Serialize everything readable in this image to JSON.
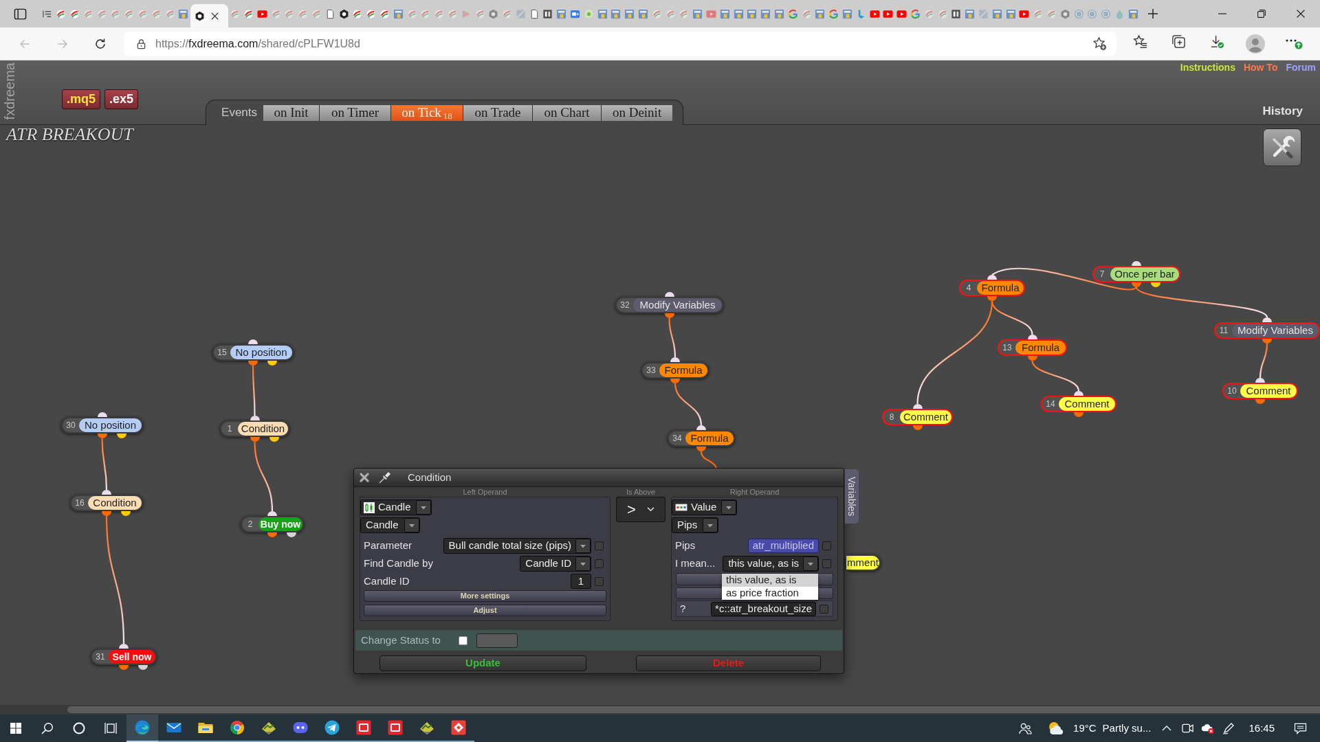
{
  "browser": {
    "tabs": [
      {
        "kind": "list",
        "asleep": false,
        "selected": false
      },
      {
        "kind": "fx",
        "asleep": false,
        "selected": false
      },
      {
        "kind": "fx",
        "asleep": false,
        "selected": false
      },
      {
        "kind": "fx",
        "asleep": true,
        "selected": false
      },
      {
        "kind": "fx",
        "asleep": true,
        "selected": false
      },
      {
        "kind": "fx",
        "asleep": true,
        "selected": false
      },
      {
        "kind": "fx",
        "asleep": true,
        "selected": false
      },
      {
        "kind": "fx",
        "asleep": true,
        "selected": false
      },
      {
        "kind": "fx",
        "asleep": true,
        "selected": false
      },
      {
        "kind": "fx",
        "asleep": true,
        "selected": false
      },
      {
        "kind": "mql",
        "asleep": false,
        "selected": false
      },
      {
        "kind": "hex",
        "asleep": false,
        "selected": true
      },
      {
        "kind": "fx",
        "asleep": true,
        "selected": false
      },
      {
        "kind": "fx",
        "asleep": false,
        "selected": false
      },
      {
        "kind": "yt",
        "asleep": false,
        "selected": false
      },
      {
        "kind": "fx",
        "asleep": true,
        "selected": false
      },
      {
        "kind": "fx",
        "asleep": true,
        "selected": false
      },
      {
        "kind": "fx",
        "asleep": true,
        "selected": false
      },
      {
        "kind": "fx",
        "asleep": true,
        "selected": false
      },
      {
        "kind": "doc",
        "asleep": false,
        "selected": false
      },
      {
        "kind": "hex",
        "asleep": false,
        "selected": false
      },
      {
        "kind": "fx",
        "asleep": false,
        "selected": false
      },
      {
        "kind": "fx",
        "asleep": false,
        "selected": false
      },
      {
        "kind": "fx",
        "asleep": false,
        "selected": false
      },
      {
        "kind": "mql",
        "asleep": false,
        "selected": false
      },
      {
        "kind": "fx",
        "asleep": true,
        "selected": false
      },
      {
        "kind": "fx",
        "asleep": true,
        "selected": false
      },
      {
        "kind": "fx",
        "asleep": true,
        "selected": false
      },
      {
        "kind": "fx",
        "asleep": true,
        "selected": false
      },
      {
        "kind": "flag",
        "asleep": true,
        "selected": false
      },
      {
        "kind": "fx",
        "asleep": true,
        "selected": false
      },
      {
        "kind": "hex",
        "asleep": true,
        "selected": false
      },
      {
        "kind": "fx",
        "asleep": true,
        "selected": false
      },
      {
        "kind": "tile",
        "asleep": true,
        "selected": false
      },
      {
        "kind": "doc",
        "asleep": false,
        "selected": false
      },
      {
        "kind": "misc",
        "asleep": false,
        "selected": false
      },
      {
        "kind": "mql",
        "asleep": false,
        "selected": false
      },
      {
        "kind": "cam",
        "asleep": false,
        "selected": false
      },
      {
        "kind": "leaf",
        "asleep": false,
        "selected": false
      },
      {
        "kind": "mql",
        "asleep": false,
        "selected": false
      },
      {
        "kind": "mql",
        "asleep": false,
        "selected": false
      },
      {
        "kind": "mql",
        "asleep": false,
        "selected": false
      },
      {
        "kind": "mql",
        "asleep": false,
        "selected": false
      },
      {
        "kind": "fx",
        "asleep": true,
        "selected": false
      },
      {
        "kind": "fx",
        "asleep": true,
        "selected": false
      },
      {
        "kind": "fx",
        "asleep": true,
        "selected": false
      },
      {
        "kind": "mql",
        "asleep": false,
        "selected": false
      },
      {
        "kind": "yt",
        "asleep": true,
        "selected": false
      },
      {
        "kind": "mql",
        "asleep": false,
        "selected": false
      },
      {
        "kind": "mql",
        "asleep": false,
        "selected": false
      },
      {
        "kind": "mql",
        "asleep": false,
        "selected": false
      },
      {
        "kind": "mql",
        "asleep": false,
        "selected": false
      },
      {
        "kind": "mql",
        "asleep": false,
        "selected": false
      },
      {
        "kind": "g",
        "asleep": false,
        "selected": false
      },
      {
        "kind": "fx",
        "asleep": true,
        "selected": false
      },
      {
        "kind": "mql",
        "asleep": false,
        "selected": false
      },
      {
        "kind": "g",
        "asleep": false,
        "selected": false
      },
      {
        "kind": "mql",
        "asleep": false,
        "selected": false
      },
      {
        "kind": "bing",
        "asleep": false,
        "selected": false
      },
      {
        "kind": "yt",
        "asleep": false,
        "selected": false
      },
      {
        "kind": "yt",
        "asleep": false,
        "selected": false
      },
      {
        "kind": "yt",
        "asleep": false,
        "selected": false
      },
      {
        "kind": "g",
        "asleep": false,
        "selected": false
      },
      {
        "kind": "fx",
        "asleep": true,
        "selected": false
      },
      {
        "kind": "fx",
        "asleep": true,
        "selected": false
      },
      {
        "kind": "misc",
        "asleep": false,
        "selected": false
      },
      {
        "kind": "mql",
        "asleep": false,
        "selected": false
      },
      {
        "kind": "tile",
        "asleep": true,
        "selected": false
      },
      {
        "kind": "mql",
        "asleep": false,
        "selected": false
      },
      {
        "kind": "mql",
        "asleep": false,
        "selected": false
      },
      {
        "kind": "yt",
        "asleep": false,
        "selected": false
      },
      {
        "kind": "fx",
        "asleep": true,
        "selected": false
      },
      {
        "kind": "fx",
        "asleep": true,
        "selected": false
      },
      {
        "kind": "hex",
        "asleep": true,
        "selected": false
      },
      {
        "kind": "wp",
        "asleep": true,
        "selected": false
      },
      {
        "kind": "wp",
        "asleep": true,
        "selected": false
      },
      {
        "kind": "wp",
        "asleep": true,
        "selected": false
      },
      {
        "kind": "drop",
        "asleep": true,
        "selected": false
      },
      {
        "kind": "mql",
        "asleep": false,
        "selected": false
      }
    ],
    "nav_buttons": [
      {
        "kind": "back",
        "disabled": true
      },
      {
        "kind": "forward",
        "disabled": true
      },
      {
        "kind": "reload",
        "disabled": false
      }
    ],
    "url": {
      "scheme": "https://",
      "host": "fxdreema.com",
      "path": "/shared/cPLFW1U8d"
    }
  },
  "app": {
    "brand": "fxdreema",
    "file_buttons": [
      {
        "label": ".mq5",
        "kind": "source"
      },
      {
        "label": ".ex5",
        "kind": "compiled"
      }
    ],
    "events_label": "Events",
    "event_tabs": [
      {
        "label": "on Init",
        "selected": false
      },
      {
        "label": "on Timer",
        "selected": false
      },
      {
        "label": "on Tick",
        "count": "18",
        "selected": true
      },
      {
        "label": "on Trade",
        "selected": false
      },
      {
        "label": "on Chart",
        "selected": false
      },
      {
        "label": "on Deinit",
        "selected": false
      }
    ],
    "links": [
      {
        "label": "Instructions",
        "color": "#c8e63c"
      },
      {
        "label": "How To",
        "color": "#ff7a48"
      },
      {
        "label": "Forum",
        "color": "#a0a0ff"
      }
    ],
    "history": "History",
    "project_title": "ATR BREAKOUT"
  },
  "nodes": [
    {
      "number": "7",
      "label": "Once per bar",
      "color": "#a9dc7a",
      "kind": "block",
      "highlighted": true,
      "outputs": [
        {
          "color": "#ff6a00"
        },
        {
          "color": "#ffcc00"
        }
      ]
    },
    {
      "number": "4",
      "label": "Formula",
      "color": "#ff8800",
      "kind": "block",
      "highlighted": true,
      "outputs": [
        {
          "color": "#ff6a00"
        }
      ]
    },
    {
      "number": "32",
      "label": "Modify Variables",
      "color": "#5c5c6c",
      "kind": "block",
      "highlighted": false,
      "outputs": [
        {
          "color": "#ff6a00"
        }
      ]
    },
    {
      "number": "11",
      "label": "Modify Variables",
      "color": "#5c5c6c",
      "kind": "block",
      "highlighted": true,
      "outputs": [
        {
          "color": "#ff6a00"
        }
      ]
    },
    {
      "number": "13",
      "label": "Formula",
      "color": "#ff8800",
      "kind": "block",
      "highlighted": true,
      "outputs": [
        {
          "color": "#ff6a00"
        }
      ]
    },
    {
      "number": "15",
      "label": "No position",
      "color": "#b3cdf6",
      "kind": "block",
      "highlighted": false,
      "outputs": [
        {
          "color": "#ff6a00"
        },
        {
          "color": "#ffcc00"
        }
      ]
    },
    {
      "number": "33",
      "label": "Formula",
      "color": "#ff8800",
      "kind": "block",
      "highlighted": false,
      "outputs": [
        {
          "color": "#ff6a00"
        }
      ]
    },
    {
      "number": "10",
      "label": "Comment",
      "color": "#ffff48",
      "kind": "block",
      "highlighted": true,
      "outputs": [
        {
          "color": "#ff6a00"
        }
      ]
    },
    {
      "number": "14",
      "label": "Comment",
      "color": "#ffff48",
      "kind": "block",
      "highlighted": true,
      "outputs": [
        {
          "color": "#ff6a00"
        }
      ]
    },
    {
      "number": "8",
      "label": "Comment",
      "color": "#ffff48",
      "kind": "block",
      "highlighted": true,
      "outputs": [
        {
          "color": "#ff6a00"
        }
      ]
    },
    {
      "number": "30",
      "label": "No position",
      "color": "#b3cdf6",
      "kind": "block",
      "highlighted": false,
      "outputs": [
        {
          "color": "#ff6a00"
        },
        {
          "color": "#ffcc00"
        }
      ]
    },
    {
      "number": "1",
      "label": "Condition",
      "color": "#fcdcb2",
      "kind": "block",
      "highlighted": false,
      "outputs": [
        {
          "color": "#ff6a00"
        },
        {
          "color": "#ffcc00"
        }
      ]
    },
    {
      "number": "34",
      "label": "Formula",
      "color": "#ff8800",
      "kind": "block",
      "highlighted": false,
      "outputs": [
        {
          "color": "#ff6a00"
        }
      ]
    },
    {
      "number": "16",
      "label": "Condition",
      "color": "#fcdcb2",
      "kind": "block",
      "highlighted": false,
      "outputs": [
        {
          "color": "#ff6a00"
        },
        {
          "color": "#ffcc00"
        }
      ]
    },
    {
      "number": "2",
      "label": "Buy now",
      "color": "#17a317",
      "kind": "trade",
      "highlighted": false,
      "outputs": [
        {
          "color": "#ff6a00"
        },
        {
          "color": "#d4d4d4"
        }
      ]
    },
    {
      "number": "31",
      "label": "Sell now",
      "color": "#ff0a0a",
      "kind": "trade",
      "highlighted": false,
      "outputs": [
        {
          "color": "#ff6a00"
        },
        {
          "color": "#d4d4d4"
        }
      ]
    },
    {
      "label": "mment",
      "color": "#ffff48",
      "kind": "block",
      "highlighted": false
    }
  ],
  "dialog": {
    "title": "Condition",
    "operands": [
      {
        "kind": "candle",
        "heading": "Left Operand",
        "source": "Candle",
        "type": "Candle",
        "fields": [
          {
            "label": "Parameter",
            "value": "Bull candle total size (pips)",
            "kind": "select",
            "checked": false
          },
          {
            "label": "Find Candle by",
            "value": "Candle ID",
            "kind": "select",
            "checked": false
          },
          {
            "label": "Candle ID",
            "value": "1",
            "kind": "input",
            "checked": false
          }
        ],
        "sections": [
          "More settings",
          "Adjust"
        ]
      },
      {
        "kind": "value",
        "heading": "Right Operand",
        "source": "Value",
        "type": "Pips",
        "fields": [
          {
            "label": "Pips",
            "value": "atr_multiplied",
            "kind": "variable",
            "checked": false
          },
          {
            "label": "I mean...",
            "value": "this value, as is",
            "kind": "select",
            "checked": false
          }
        ],
        "menu": [
          {
            "label": "this value, as is",
            "selected": true
          },
          {
            "label": "as price fraction",
            "selected": false
          }
        ],
        "extra": {
          "label": "?",
          "value": "*c::atr_breakout_size",
          "checked": false
        }
      }
    ],
    "operator": {
      "heading": "Is Above",
      "value": ">"
    },
    "status": {
      "label": "Change Status to",
      "checked": false
    },
    "buttons": [
      {
        "label": "Update",
        "color": "#3dbb3d"
      },
      {
        "label": "Delete",
        "color": "#e41b1b"
      }
    ],
    "side_tab": "Variables"
  },
  "taskbar": {
    "buttons": [
      {
        "kind": "start"
      },
      {
        "kind": "search"
      },
      {
        "kind": "cortana"
      },
      {
        "kind": "task-view"
      }
    ],
    "apps": [
      {
        "kind": "edge",
        "selected": true,
        "running": true
      },
      {
        "kind": "mail",
        "selected": false,
        "running": true
      },
      {
        "kind": "explorer",
        "selected": false,
        "running": true
      },
      {
        "kind": "chrome",
        "selected": false,
        "running": true
      },
      {
        "kind": "trader",
        "selected": false,
        "running": true
      },
      {
        "kind": "discord",
        "selected": false,
        "running": true
      },
      {
        "kind": "telegram",
        "selected": false,
        "running": true
      },
      {
        "kind": "ig",
        "selected": false,
        "running": true
      },
      {
        "kind": "ig",
        "selected": false,
        "running": true
      },
      {
        "kind": "trader",
        "selected": false,
        "running": true
      },
      {
        "kind": "remote",
        "selected": false,
        "running": true
      }
    ],
    "weather": {
      "temperature": "19°C",
      "summary": "Partly su..."
    },
    "tray": [
      {
        "kind": "caret"
      },
      {
        "kind": "meet"
      },
      {
        "kind": "cloud"
      },
      {
        "kind": "pen"
      }
    ],
    "clock": "16:45"
  }
}
